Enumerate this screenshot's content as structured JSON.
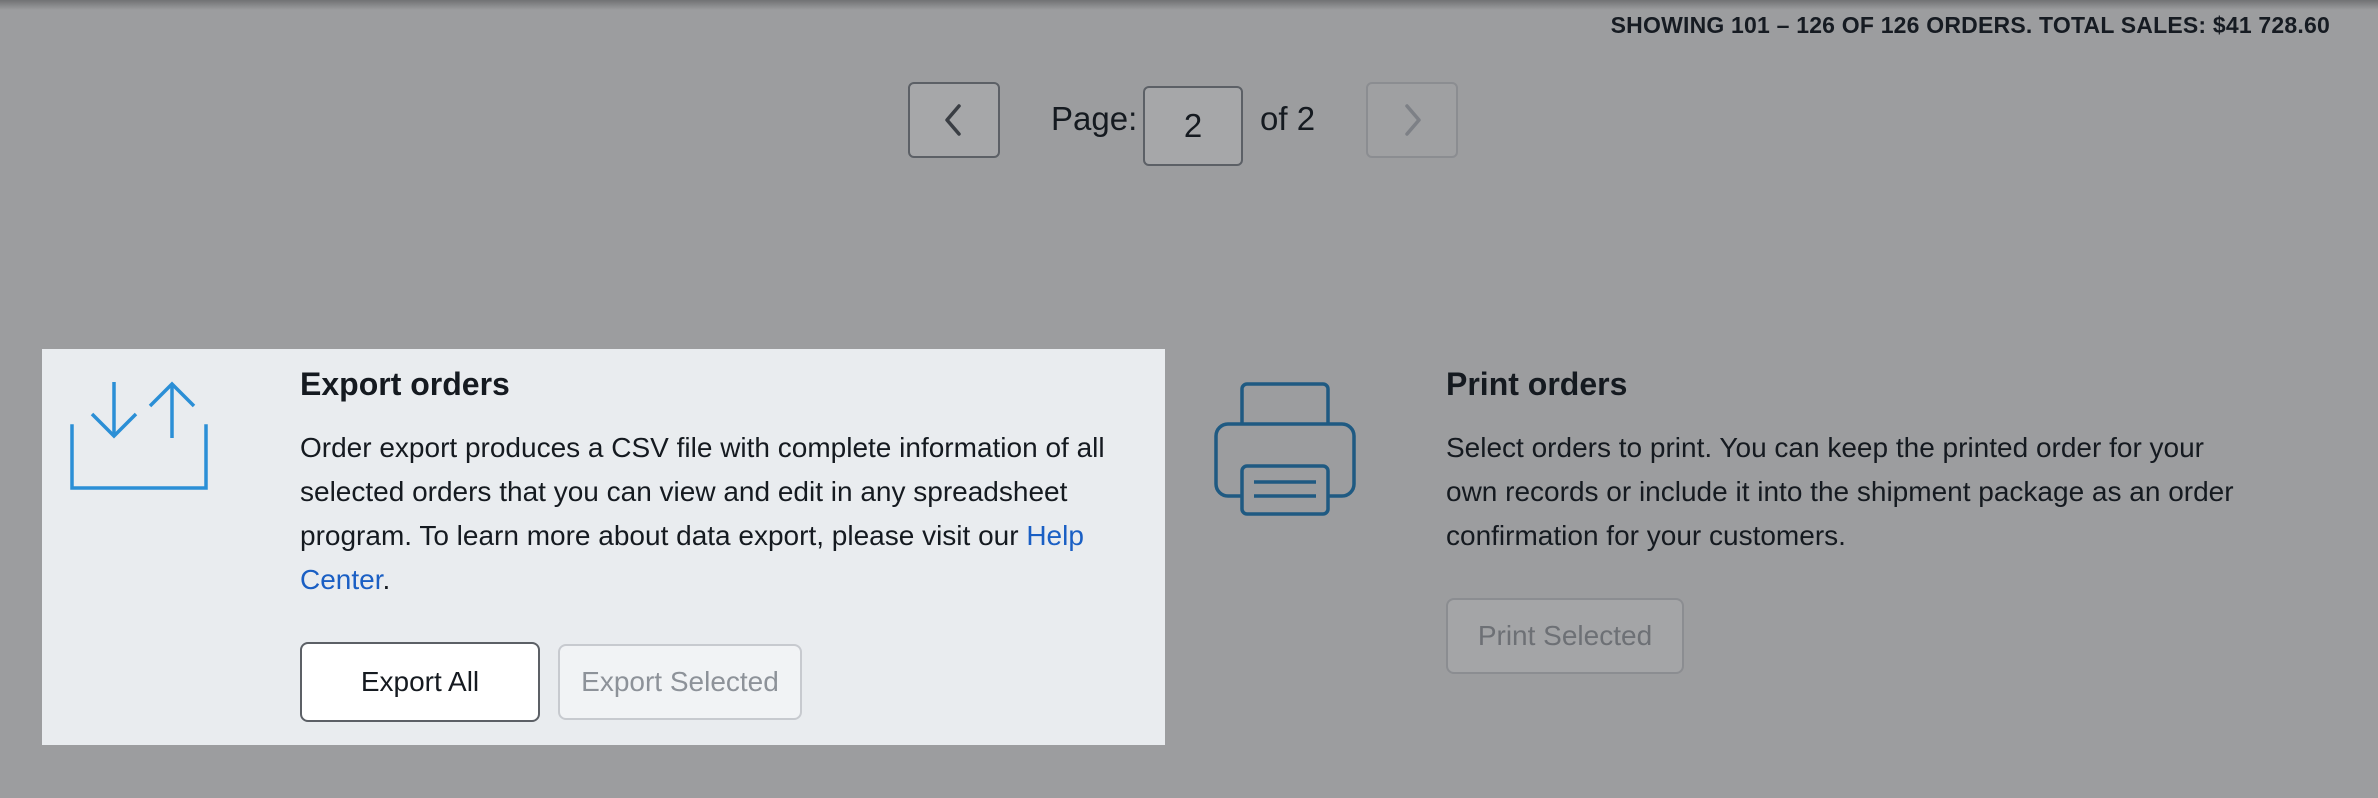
{
  "summary": {
    "text": "SHOWING 101 – 126 OF 126 ORDERS. TOTAL SALES: $41 728.60"
  },
  "pagination": {
    "page_label": "Page:",
    "current_page": "2",
    "of_label": "of 2",
    "prev_icon": "chevron-left-icon",
    "next_icon": "chevron-right-icon"
  },
  "export": {
    "title": "Export orders",
    "description": "Order export produces a CSV file with complete information of all selected orders that you can view and edit in any spreadsheet program. To learn more about data export, please visit our ",
    "link_text": "Help Center",
    "description_end": ".",
    "export_all_label": "Export All",
    "export_selected_label": "Export Selected",
    "icon": "export-upload-download-icon"
  },
  "print": {
    "title": "Print orders",
    "description": "Select orders to print. You can keep the printed order for your own records or include it into the shipment package as an order confirmation for your customers.",
    "print_selected_label": "Print Selected",
    "icon": "printer-icon"
  },
  "colors": {
    "overlay_background": "#9c9d9f",
    "export_card_background": "#e9ecef",
    "export_icon": "#2b8fd6",
    "print_icon": "#1f5a82",
    "link": "#1a5fc4"
  }
}
